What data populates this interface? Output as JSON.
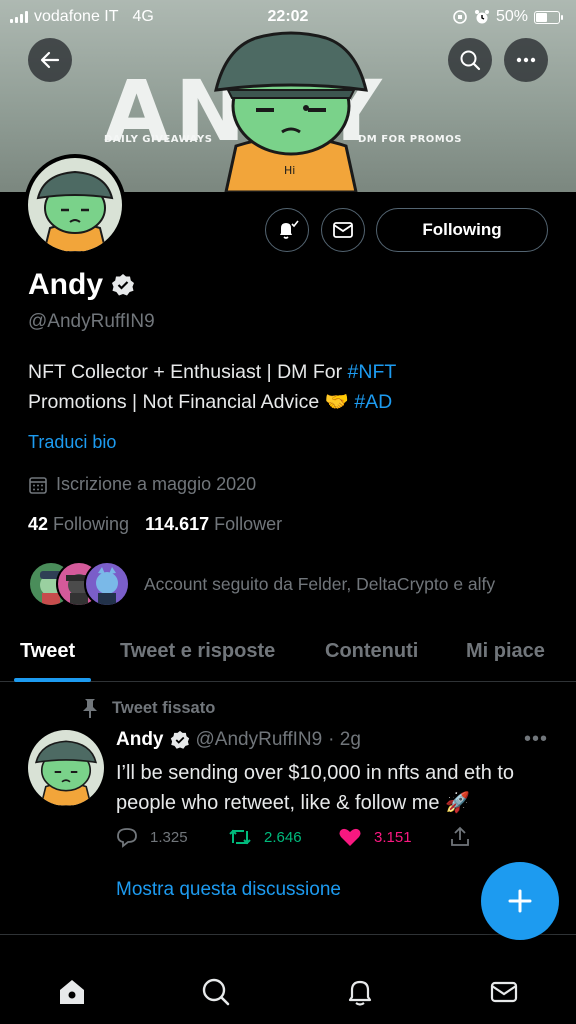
{
  "status_bar": {
    "carrier": "vodafone IT",
    "network": "4G",
    "time": "22:02",
    "battery": "50%",
    "battery_level": 0.5
  },
  "banner": {
    "title": "ANDY",
    "left_caption": "DAILY GIVEAWAYS",
    "right_caption": "DM FOR PROMOS",
    "shirt_text": "Hi"
  },
  "header_buttons": {
    "back_icon": "arrow-left-icon",
    "search_icon": "search-icon",
    "more_icon": "more-horizontal-icon"
  },
  "profile": {
    "name": "Andy",
    "handle": "@AndyRuffIN9",
    "bio_part1": "NFT Collector + Enthusiast | DM For ",
    "bio_tag1": "#NFT",
    "bio_part2": "Promotions | Not Financial Advice 🤝 ",
    "bio_tag2": "#AD",
    "translate": "Traduci bio",
    "joined": "Iscrizione a maggio 2020",
    "following_count": "42",
    "following_label": "Following",
    "followers_count": "114.617",
    "followers_label": "Follower",
    "followed_by": "Account seguito da Felder, DeltaCrypto e alfy",
    "follow_button": "Following",
    "verified_icon": "verified-badge-icon",
    "notifications_icon": "bell-check-icon",
    "message_icon": "envelope-icon"
  },
  "tabs": [
    {
      "label": "Tweet",
      "active": true
    },
    {
      "label": "Tweet e risposte",
      "active": false
    },
    {
      "label": "Contenuti",
      "active": false
    },
    {
      "label": "Mi piace",
      "active": false
    }
  ],
  "pinned_tweet": {
    "pin_label": "Tweet fissato",
    "author_name": "Andy",
    "author_handle": "@AndyRuffIN9",
    "time": "· 2g",
    "text": "I’ll be sending over $10,000 in nfts and eth to people who retweet, like & follow me 🚀",
    "replies": "1.325",
    "retweets": "2.646",
    "likes": "3.151",
    "show_thread": "Mostra questa discussione",
    "more": "•••"
  },
  "colors": {
    "accent": "#1d9bf0",
    "retweet": "#00ba7c",
    "like": "#f91880",
    "muted": "#71767b",
    "background": "#000000"
  },
  "bottom_nav": [
    "home-icon",
    "search-icon",
    "bell-icon",
    "mail-icon"
  ],
  "compose_icon": "plus-icon"
}
